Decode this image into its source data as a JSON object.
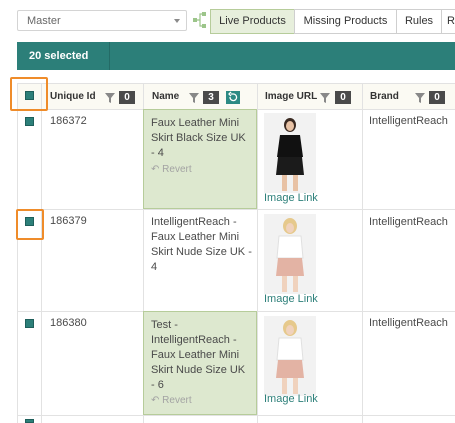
{
  "toolbar": {
    "catalog_select_value": "Master",
    "tabs": [
      "Live Products",
      "Missing Products",
      "Rules",
      "R"
    ]
  },
  "selection": {
    "label": "20 selected"
  },
  "table": {
    "columns": [
      {
        "label": "Unique Id",
        "count": "0"
      },
      {
        "label": "Name",
        "count": "3"
      },
      {
        "label": "Image URL",
        "count": "0"
      },
      {
        "label": "Brand",
        "count": "0"
      }
    ],
    "rows": [
      {
        "id": "186372",
        "name": "Faux Leather Mini Skirt Black Size UK - 4",
        "edited": true,
        "revert": "Revert",
        "image_link": "Image Link",
        "brand": "IntelligentReach"
      },
      {
        "id": "186379",
        "name": "IntelligentReach - Faux Leather Mini Skirt Nude Size UK - 4",
        "edited": false,
        "image_link": "Image Link",
        "brand": "IntelligentReach"
      },
      {
        "id": "186380",
        "name": "Test - IntelligentReach - Faux Leather Mini Skirt Nude Size UK - 6",
        "edited": true,
        "revert": "Revert",
        "image_link": "Image Link",
        "brand": "IntelligentReach"
      }
    ]
  },
  "colors": {
    "accent": "#2c7f79",
    "highlight": "#ef8c2a",
    "edited_bg": "#dde8cf"
  }
}
